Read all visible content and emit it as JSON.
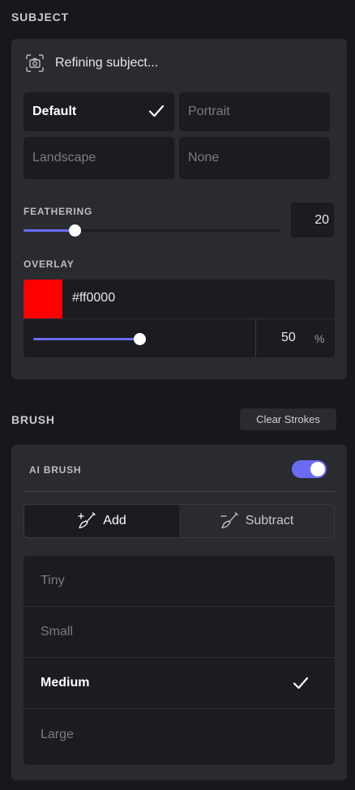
{
  "subject": {
    "title": "SUBJECT",
    "status_text": "Refining subject...",
    "modes": [
      {
        "label": "Default",
        "selected": true
      },
      {
        "label": "Portrait",
        "selected": false
      },
      {
        "label": "Landscape",
        "selected": false
      },
      {
        "label": "None",
        "selected": false
      }
    ],
    "feathering": {
      "label": "FEATHERING",
      "value": "20",
      "level": 0.2
    },
    "overlay": {
      "label": "OVERLAY",
      "color": "#ff0000",
      "hex_text": "#ff0000",
      "opacity_value": "50",
      "opacity_unit": "%",
      "level": 0.5
    }
  },
  "brush": {
    "title": "BRUSH",
    "clear_label": "Clear Strokes",
    "ai_brush_label": "AI BRUSH",
    "ai_brush_enabled": true,
    "tools": [
      {
        "label": "Add",
        "icon": "brush-add-icon",
        "selected": true
      },
      {
        "label": "Subtract",
        "icon": "brush-subtract-icon",
        "selected": false
      }
    ],
    "sizes": [
      {
        "label": "Tiny",
        "selected": false
      },
      {
        "label": "Small",
        "selected": false
      },
      {
        "label": "Medium",
        "selected": true
      },
      {
        "label": "Large",
        "selected": false
      }
    ]
  },
  "colors": {
    "accent": "#6a6bf2",
    "background": "#17171d",
    "panel": "#2a2a31",
    "field": "#1b1b21"
  }
}
